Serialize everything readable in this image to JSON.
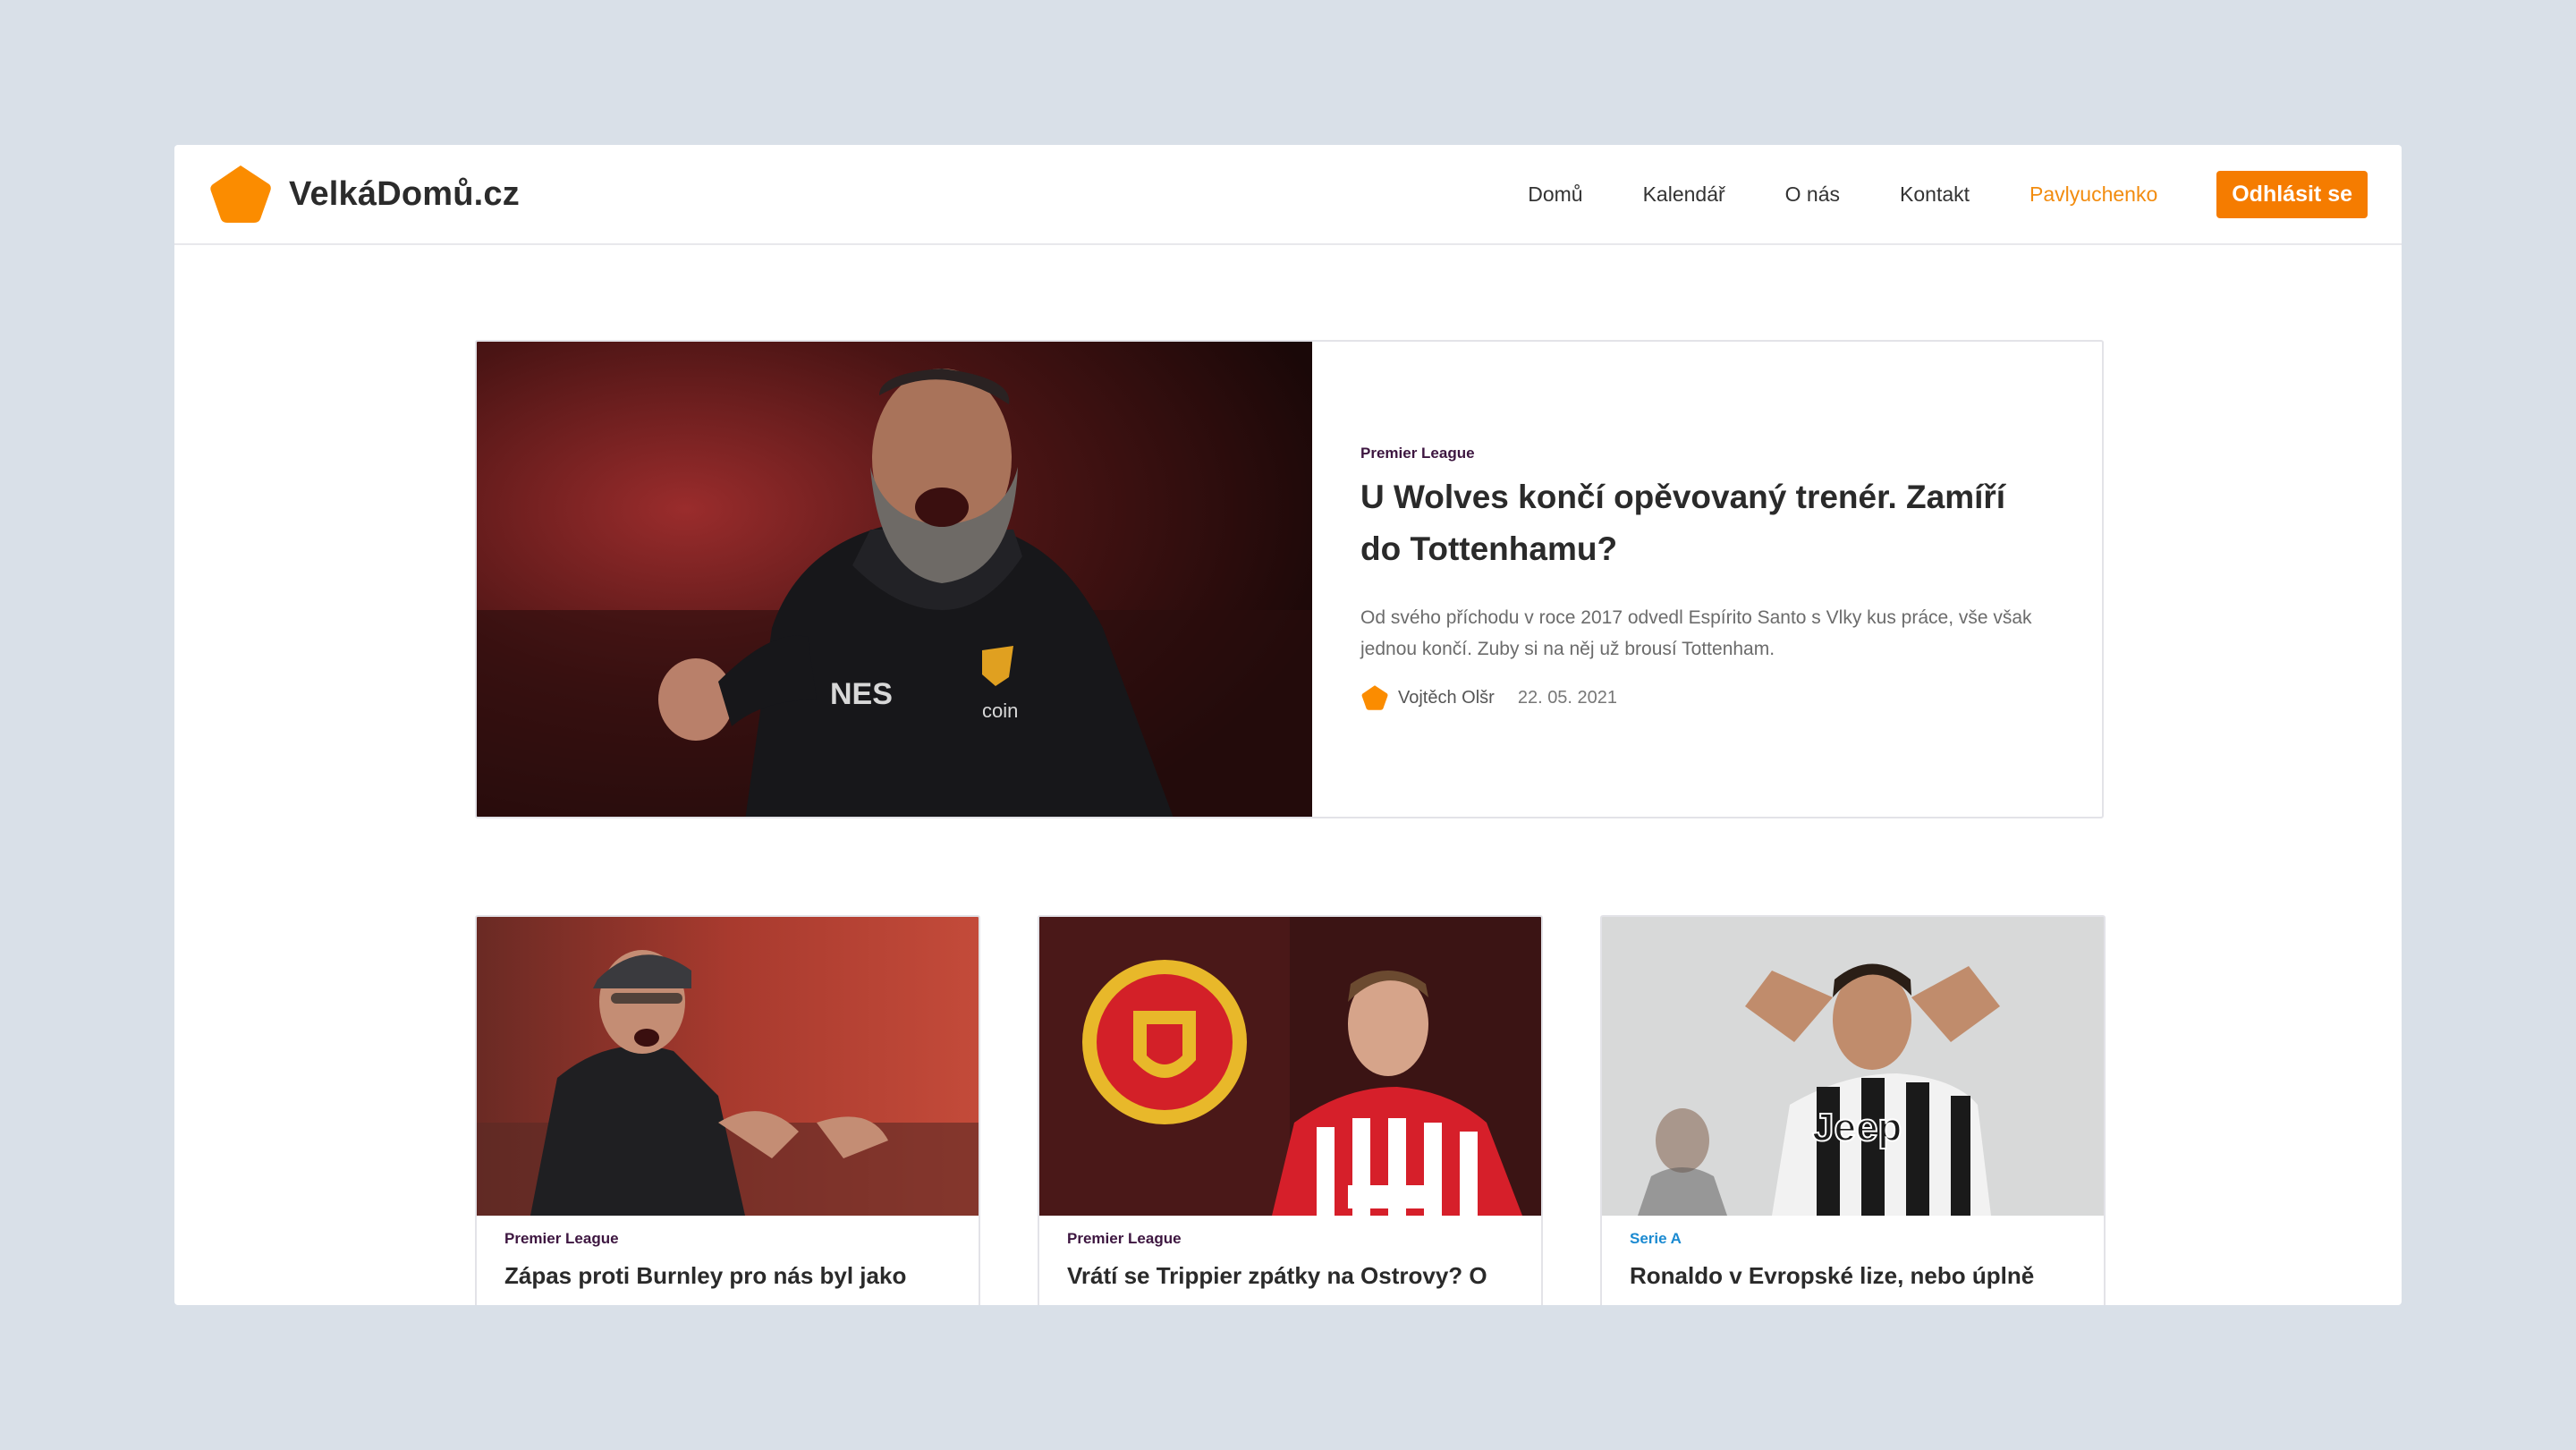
{
  "brand": {
    "name": "VelkáDomů.cz",
    "logo_icon": "pentagon-logo-icon",
    "accent": "#f57c00"
  },
  "nav": {
    "links": [
      "Domů",
      "Kalendář",
      "O nás",
      "Kontakt"
    ],
    "user": "Pavlyuchenko",
    "logout": "Odhlásit se"
  },
  "featured": {
    "category": "Premier League",
    "title": "U Wolves končí opěvovaný trenér. Zamíří do Tottenhamu?",
    "excerpt": "Od svého příchodu v roce 2017 odvedl Espírito Santo s Vlky kus práce, vše však jednou končí. Zuby si na něj už brousí Tottenham.",
    "author": "Vojtěch Olšr",
    "date": "22. 05. 2021",
    "image": "coach-celebrating-photo"
  },
  "cards": [
    {
      "category": "Premier League",
      "title": "Zápas proti Burnley pro nás byl jako",
      "image": "coach-shouting-photo"
    },
    {
      "category": "Premier League",
      "title": "Vrátí se Trippier zpátky na Ostrovy? O",
      "image": "player-with-club-crest-photo"
    },
    {
      "category": "Serie A",
      "title": "Ronaldo v Evropské lize, nebo úplně",
      "image": "player-hands-on-head-photo"
    }
  ]
}
